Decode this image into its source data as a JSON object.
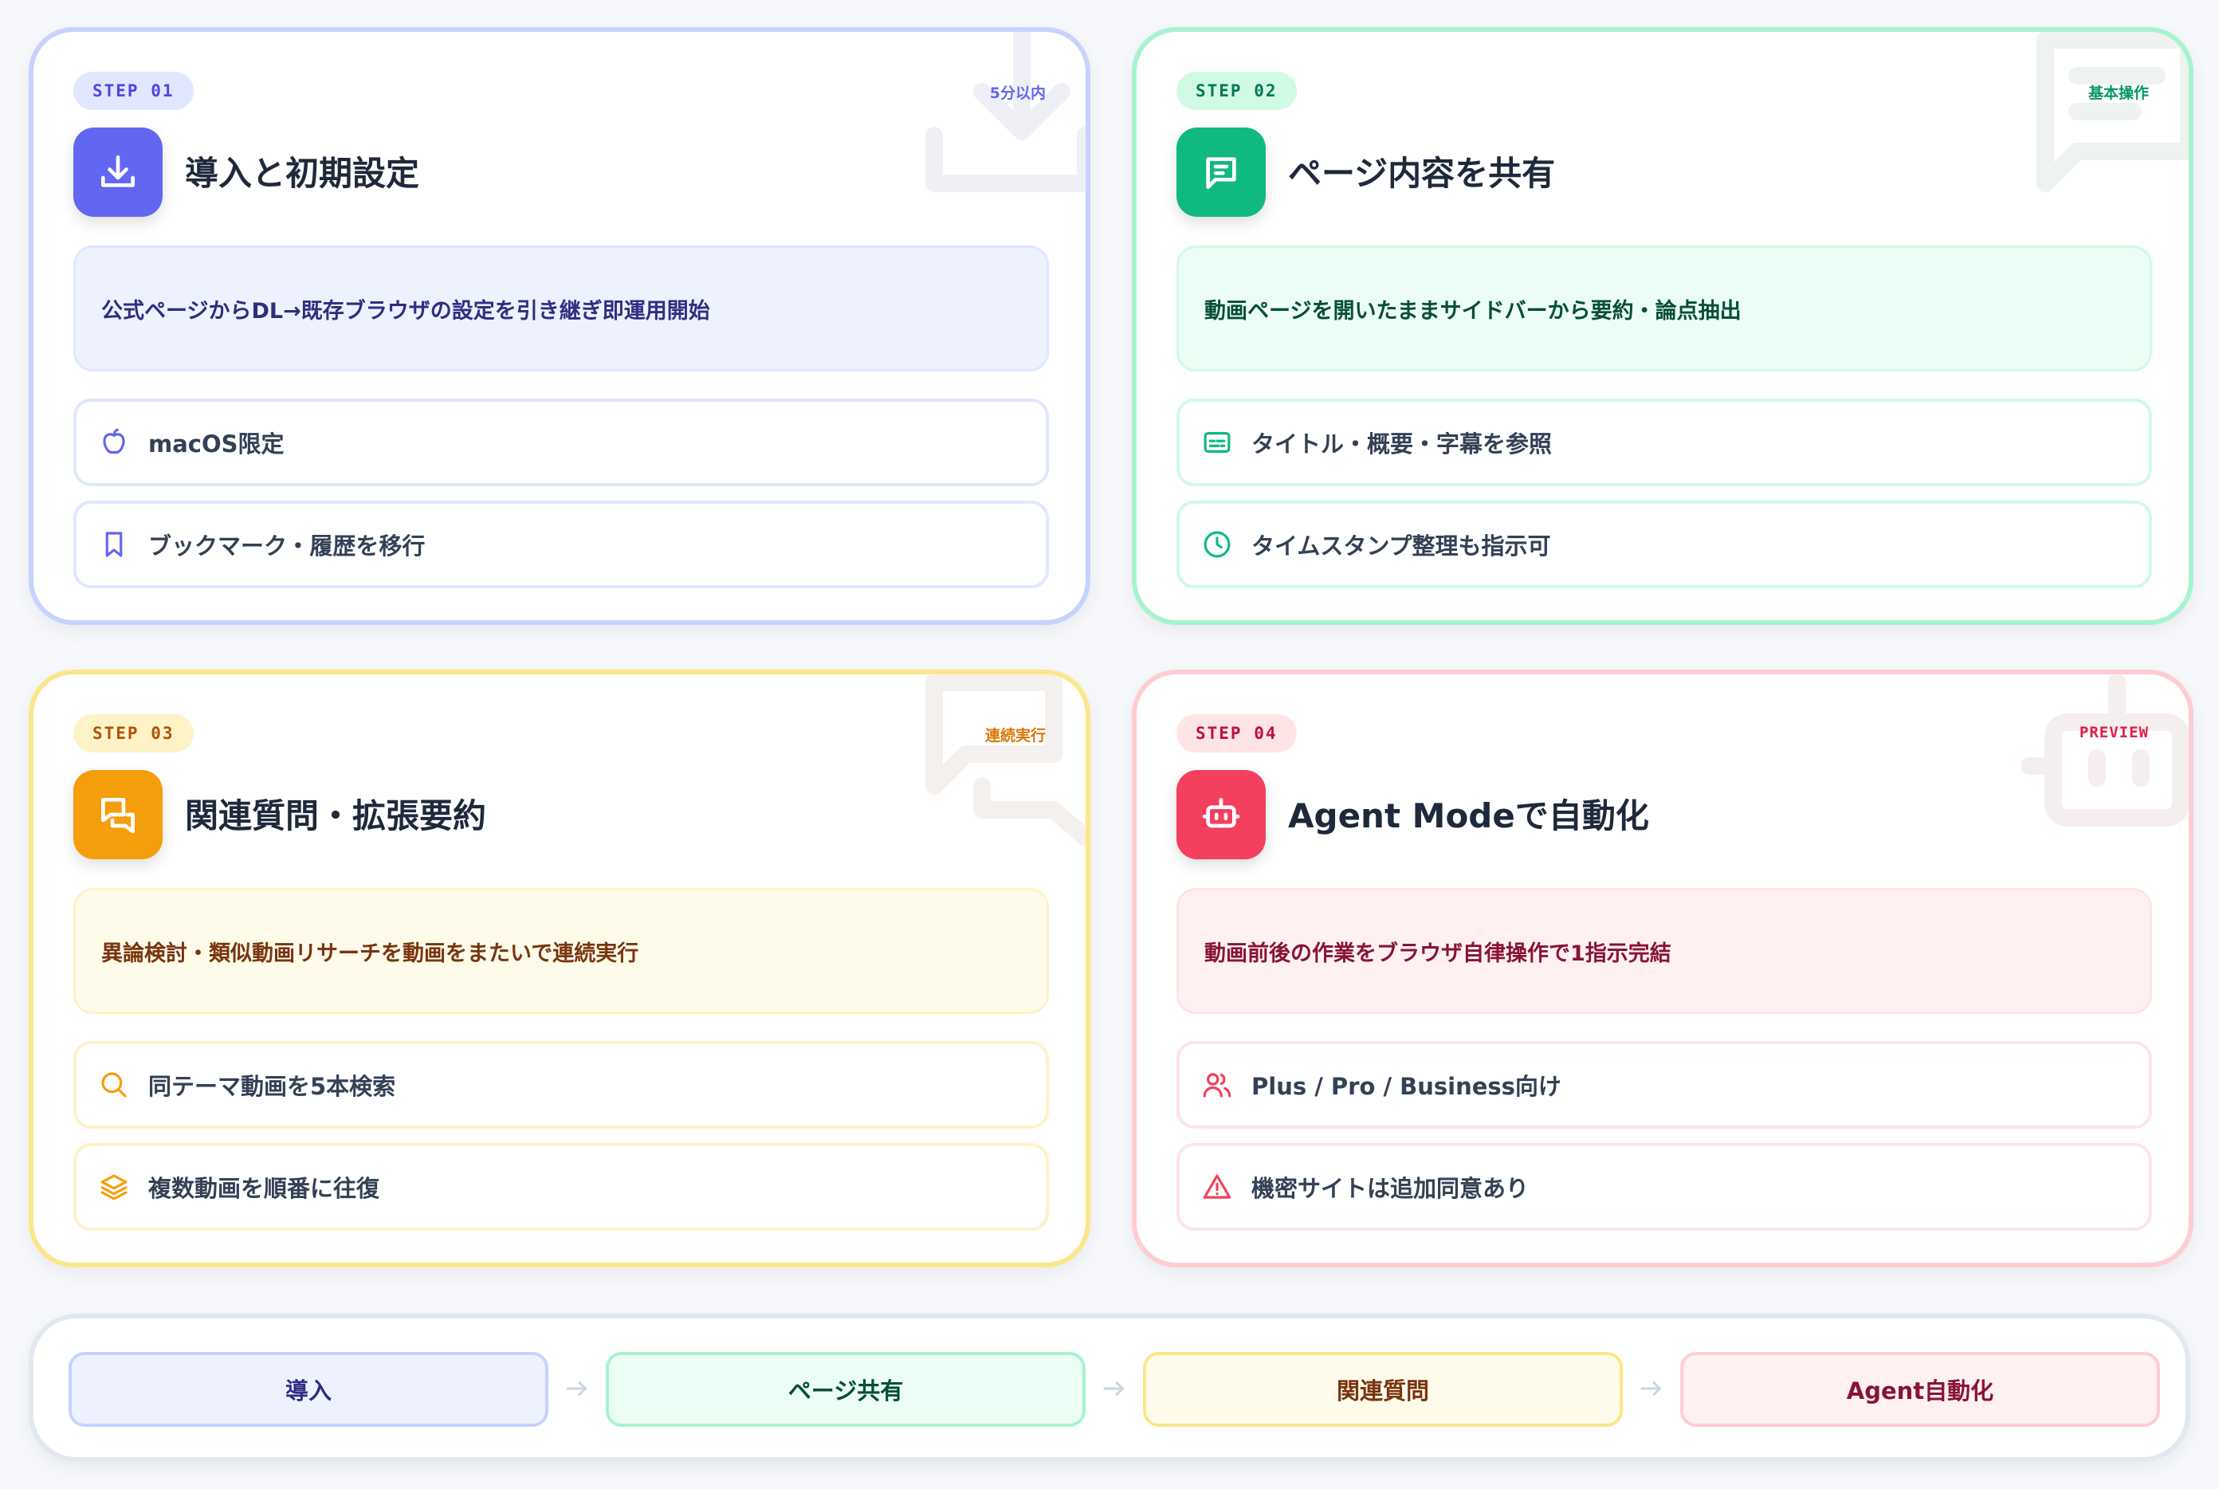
{
  "colors": {
    "indigo": "#6366f1",
    "emerald": "#10b981",
    "amber": "#f59e0b",
    "rose": "#f43f5e"
  },
  "cards": [
    {
      "step": "STEP 01",
      "tag": "5分以内",
      "title": "導入と初期設定",
      "icon": "download-icon",
      "description": "公式ページからDL→既存ブラウザの設定を引き継ぎ即運用開始",
      "items": [
        {
          "icon": "apple-icon",
          "label": "macOS限定"
        },
        {
          "icon": "bookmark-icon",
          "label": "ブックマーク・履歴を移行"
        }
      ]
    },
    {
      "step": "STEP 02",
      "tag": "基本操作",
      "title": "ページ内容を共有",
      "icon": "message-icon",
      "description": "動画ページを開いたままサイドバーから要約・論点抽出",
      "items": [
        {
          "icon": "subtitles-icon",
          "label": "タイトル・概要・字幕を参照"
        },
        {
          "icon": "clock-icon",
          "label": "タイムスタンプ整理も指示可"
        }
      ]
    },
    {
      "step": "STEP 03",
      "tag": "連続実行",
      "title": "関連質問・拡張要約",
      "icon": "chat-icon",
      "description": "異論検討・類似動画リサーチを動画をまたいで連続実行",
      "items": [
        {
          "icon": "search-icon",
          "label": "同テーマ動画を5本検索"
        },
        {
          "icon": "layers-icon",
          "label": "複数動画を順番に往復"
        }
      ]
    },
    {
      "step": "STEP 04",
      "tag": "PREVIEW",
      "title": "Agent Modeで自動化",
      "icon": "robot-icon",
      "description": "動画前後の作業をブラウザ自律操作で1指示完結",
      "items": [
        {
          "icon": "users-icon",
          "label": "Plus / Pro / Business向け"
        },
        {
          "icon": "warning-icon",
          "label": "機密サイトは追加同意あり"
        }
      ]
    }
  ],
  "flow": [
    {
      "label": "導入"
    },
    {
      "label": "ページ共有"
    },
    {
      "label": "関連質問"
    },
    {
      "label": "Agent自動化"
    }
  ]
}
